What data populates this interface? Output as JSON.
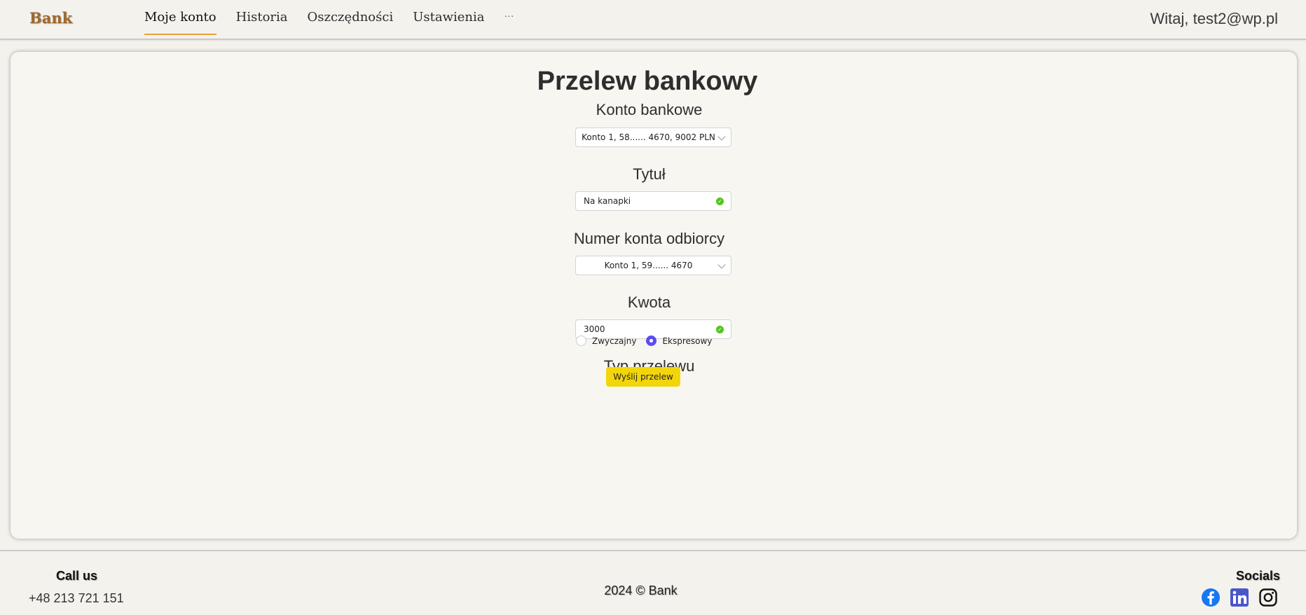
{
  "header": {
    "logo": "Bank",
    "nav": [
      {
        "label": "Moje konto",
        "active": true
      },
      {
        "label": "Historia",
        "active": false
      },
      {
        "label": "Oszczędności",
        "active": false
      },
      {
        "label": "Ustawienia",
        "active": false
      }
    ],
    "more": "···",
    "greeting": "Witaj, test2@wp.pl"
  },
  "form": {
    "title": "Przelew bankowy",
    "account_label": "Konto bankowe",
    "account_value": "Konto 1, 58...... 4670, 9002 PLN",
    "title_label": "Tytuł",
    "title_value": "Na kanapki",
    "recipient_label": "Numer konta odbiorcy",
    "recipient_value": "Konto 1, 59...... 4670",
    "amount_label": "Kwota",
    "amount_value": "3000",
    "type_label": "Typ przelewu",
    "type_options": [
      {
        "label": "Zwyczajny",
        "checked": false
      },
      {
        "label": "Ekspresowy",
        "checked": true
      }
    ],
    "submit": "Wyślij przelew"
  },
  "footer": {
    "call_title": "Call us",
    "phone": "+48 213 721 151",
    "copyright": "2024 © Bank",
    "socials_title": "Socials",
    "socials": [
      "facebook-icon",
      "linkedin-icon",
      "instagram-icon"
    ]
  },
  "colors": {
    "accent_underline": "#e8a33d",
    "logo": "#a0692a",
    "submit_bg": "#f2d60a",
    "radio_checked": "#5b4cf0",
    "valid_check": "#52c41a",
    "facebook": "#1877f2",
    "linkedin": "#4a56c9"
  }
}
